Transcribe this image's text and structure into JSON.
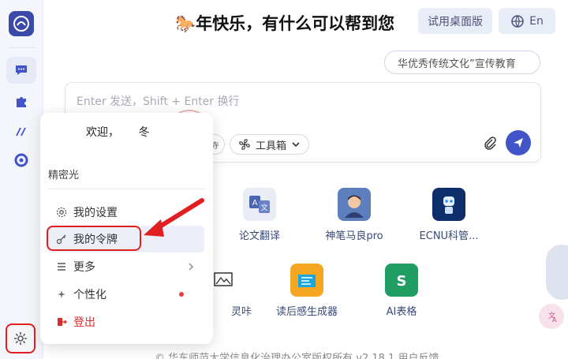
{
  "header": {
    "title": "🐎年快乐，有什么可以帮到您",
    "desktop_button": "试用桌面版",
    "lang_button": "En"
  },
  "marquee": {
    "text": "华优秀传统文化”宣传教育"
  },
  "input": {
    "placeholder": "Enter 发送，Shift + Enter 换行",
    "partial_pill": "寺",
    "toolbox_label": "工具箱"
  },
  "apps": [
    {
      "label": "论文翻译",
      "icon": "translate-icon"
    },
    {
      "label": "神笔马良pro",
      "icon": "avatar-boy-icon"
    },
    {
      "label": "ECNU科管...",
      "icon": "robot-icon"
    },
    {
      "label": "灵咔",
      "icon": "sketch-icon"
    },
    {
      "label": "读后感生成器",
      "icon": "reading-icon"
    },
    {
      "label": "AI表格",
      "icon": "sheet-icon"
    }
  ],
  "popup": {
    "welcome": "欢迎，",
    "welcome_name": "冬",
    "org": "精密光",
    "menu": [
      {
        "label": "我的设置",
        "icon": "gear-icon"
      },
      {
        "label": "我的令牌",
        "icon": "key-icon"
      },
      {
        "label": "更多",
        "icon": "more-icon"
      },
      {
        "label": "个性化",
        "icon": "sparkle-icon"
      },
      {
        "label": "登出",
        "icon": "logout-icon"
      }
    ]
  },
  "footer": {
    "text": "© 华东师范大学信息化治理办公室版权所有 v2.18.1   用户反馈"
  },
  "colors": {
    "accent": "#4155c8",
    "highlight_red": "#e02020",
    "logout_red": "#d92c2c"
  }
}
